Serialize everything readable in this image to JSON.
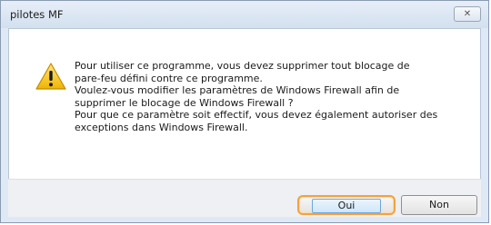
{
  "window": {
    "title": "pilotes MF",
    "close_symbol": "✕"
  },
  "dialog": {
    "icon": "warning-icon",
    "message_lines": [
      "Pour utiliser ce programme, vous devez supprimer tout blocage de",
      "pare-feu défini contre ce programme.",
      "Voulez-vous modifier les paramètres de Windows Firewall afin de",
      "supprimer le blocage de Windows Firewall ?",
      "Pour que ce paramètre soit effectif, vous devez également autoriser des",
      "exceptions dans Windows Firewall."
    ]
  },
  "buttons": {
    "yes_label": "Oui",
    "no_label": "Non"
  },
  "colors": {
    "highlight_ring": "#f3a33a",
    "warning_yellow": "#f5c518"
  }
}
